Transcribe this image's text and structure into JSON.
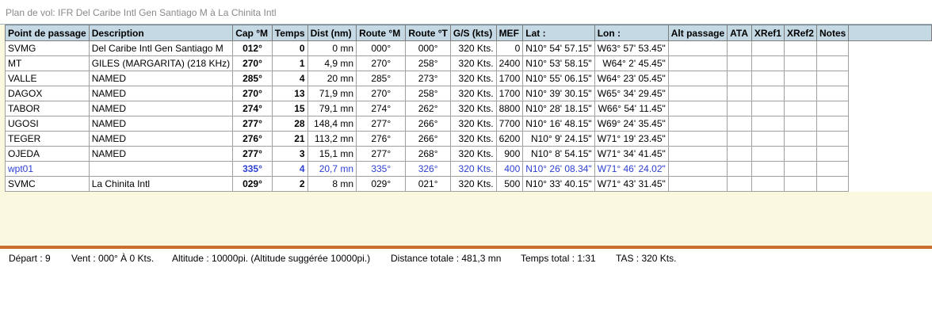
{
  "title": "Plan de vol: IFR Del Caribe Intl Gen Santiago M à La Chinita Intl",
  "columns": [
    "Point de passage",
    "Description",
    "Cap °M",
    "Temps",
    "Dist (nm)",
    "Route °M",
    "Route °T",
    "G/S (kts)",
    "MEF",
    "Lat :",
    "Lon :",
    "Alt passage",
    "ATA",
    "XRef1",
    "XRef2",
    "Notes",
    ""
  ],
  "rows": [
    {
      "wp": "SVMG",
      "desc": "Del Caribe Intl Gen Santiago M",
      "cap": "012°",
      "temps": "0",
      "dist": "0 mn",
      "rm": "000°",
      "rt": "000°",
      "gs": "320 Kts.",
      "mef": "0",
      "lat": "N10° 54' 57.15\"",
      "lon": "W63° 57' 53.45\""
    },
    {
      "wp": "MT",
      "desc": "GILES (MARGARITA) (218 KHz)",
      "cap": "270°",
      "temps": "1",
      "dist": "4,9 mn",
      "rm": "270°",
      "rt": "258°",
      "gs": "320 Kts.",
      "mef": "2400",
      "lat": "N10° 53' 58.15\"",
      "lon": "W64° 2' 45.45\""
    },
    {
      "wp": "VALLE",
      "desc": "NAMED",
      "cap": "285°",
      "temps": "4",
      "dist": "20 mn",
      "rm": "285°",
      "rt": "273°",
      "gs": "320 Kts.",
      "mef": "1700",
      "lat": "N10° 55' 06.15\"",
      "lon": "W64° 23' 05.45\""
    },
    {
      "wp": "DAGOX",
      "desc": "NAMED",
      "cap": "270°",
      "temps": "13",
      "dist": "71,9 mn",
      "rm": "270°",
      "rt": "258°",
      "gs": "320 Kts.",
      "mef": "1700",
      "lat": "N10° 39' 30.15\"",
      "lon": "W65° 34' 29.45\""
    },
    {
      "wp": "TABOR",
      "desc": "NAMED",
      "cap": "274°",
      "temps": "15",
      "dist": "79,1 mn",
      "rm": "274°",
      "rt": "262°",
      "gs": "320 Kts.",
      "mef": "8800",
      "lat": "N10° 28' 18.15\"",
      "lon": "W66° 54' 11.45\""
    },
    {
      "wp": "UGOSI",
      "desc": "NAMED",
      "cap": "277°",
      "temps": "28",
      "dist": "148,4 mn",
      "rm": "277°",
      "rt": "266°",
      "gs": "320 Kts.",
      "mef": "7700",
      "lat": "N10° 16' 48.15\"",
      "lon": "W69° 24' 35.45\""
    },
    {
      "wp": "TEGER",
      "desc": "NAMED",
      "cap": "276°",
      "temps": "21",
      "dist": "113,2 mn",
      "rm": "276°",
      "rt": "266°",
      "gs": "320 Kts.",
      "mef": "6200",
      "lat": "N10° 9' 24.15\"",
      "lon": "W71° 19' 23.45\""
    },
    {
      "wp": "OJEDA",
      "desc": "NAMED",
      "cap": "277°",
      "temps": "3",
      "dist": "15,1 mn",
      "rm": "277°",
      "rt": "268°",
      "gs": "320 Kts.",
      "mef": "900",
      "lat": "N10° 8' 54.15\"",
      "lon": "W71° 34' 41.45\""
    },
    {
      "wp": "wpt01",
      "desc": "",
      "cap": "335°",
      "temps": "4",
      "dist": "20,7 mn",
      "rm": "335°",
      "rt": "326°",
      "gs": "320 Kts.",
      "mef": "400",
      "lat": "N10° 26' 08.34\"",
      "lon": "W71° 46' 24.02\""
    },
    {
      "wp": "SVMC",
      "desc": "La Chinita Intl",
      "cap": "029°",
      "temps": "2",
      "dist": "8 mn",
      "rm": "029°",
      "rt": "021°",
      "gs": "320 Kts.",
      "mef": "500",
      "lat": "N10° 33' 40.15\"",
      "lon": "W71° 43' 31.45\""
    }
  ],
  "status": {
    "depart": "Départ :  9",
    "vent": "Vent :  000° À 0 Kts.",
    "altitude": "Altitude :  10000pi. (Altitude suggérée 10000pi.)",
    "distance": "Distance totale :  481,3 mn",
    "temps": "Temps total :  1:31",
    "tas": "TAS :  320 Kts."
  },
  "colors": {
    "header_bg": "#c5d9e4",
    "empty_area": "#fbf8e0",
    "separator": "#c8702e",
    "user_waypoint_text": "#2b3fd1"
  }
}
